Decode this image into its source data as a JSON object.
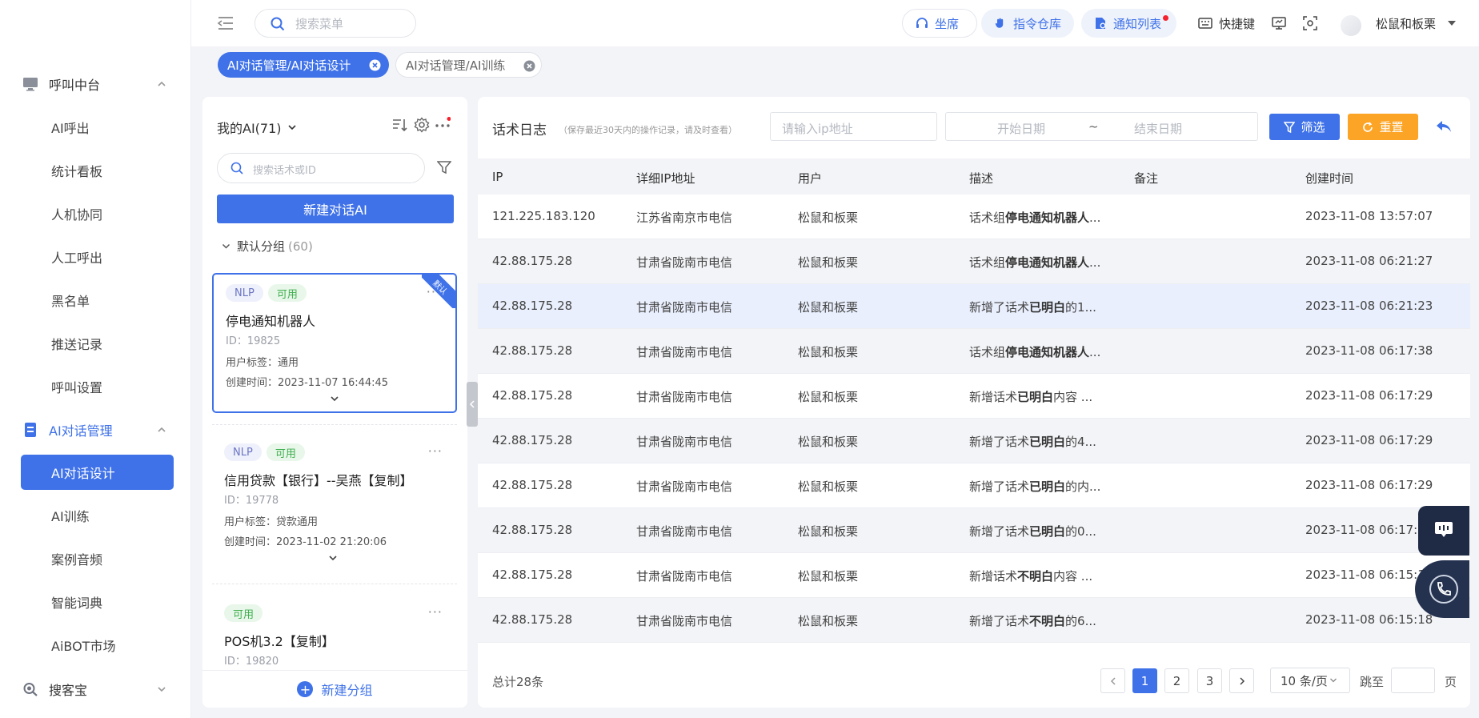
{
  "sidebar": {
    "groups": [
      {
        "label": "呼叫中台",
        "icon": "monitor-icon",
        "expanded": true
      },
      {
        "label": "AI对话管理",
        "icon": "document-icon",
        "expanded": true
      },
      {
        "label": "搜客宝",
        "icon": "magnifier-icon",
        "expanded": false
      }
    ],
    "call_items": [
      "AI呼出",
      "统计看板",
      "人机协同",
      "人工呼出",
      "黑名单",
      "推送记录",
      "呼叫设置"
    ],
    "ai_items": [
      "AI对话设计",
      "AI训练",
      "案例音频",
      "智能词典",
      "AiBOT市场"
    ],
    "active_item": "AI对话设计"
  },
  "header": {
    "search_placeholder": "搜索菜单",
    "buttons": [
      {
        "label": "坐席",
        "icon": "headset-icon"
      },
      {
        "label": "指令仓库",
        "icon": "hand-icon"
      },
      {
        "label": "通知列表",
        "icon": "bell-doc-icon",
        "has_dot": true
      }
    ],
    "shortcut_label": "快捷键",
    "username": "松鼠和板栗"
  },
  "tabs": [
    {
      "label": "AI对话管理/AI对话设计",
      "active": true
    },
    {
      "label": "AI对话管理/AI训练",
      "active": false
    }
  ],
  "ai_panel": {
    "title": "我的AI(71)",
    "search_placeholder": "搜索话术或ID",
    "new_button": "新建对话AI",
    "group_label": "默认分组",
    "group_count": "(60)",
    "cards": [
      {
        "badges": [
          "NLP",
          "可用"
        ],
        "name": "停电通知机器人",
        "id": "ID：19825",
        "tag": "用户标签：通用",
        "time": "创建时间：2023-11-07 16:44:45",
        "ribbon": "默认",
        "selected": true
      },
      {
        "badges": [
          "NLP",
          "可用"
        ],
        "name": "信用贷款【银行】--吴燕【复制】",
        "id": "ID：19778",
        "tag": "用户标签：贷款通用",
        "time": "创建时间：2023-11-02 21:20:06",
        "selected": false
      },
      {
        "badges": [
          "可用"
        ],
        "name": "POS机3.2【复制】",
        "id": "ID：19820",
        "selected": false
      }
    ],
    "new_group": "新建分组"
  },
  "log_panel": {
    "title": "话术日志",
    "subtitle": "（保存最近30天内的操作记录，请及时查看）",
    "ip_placeholder": "请输入ip地址",
    "date_start": "开始日期",
    "date_sep": "~",
    "date_end": "结束日期",
    "filter_label": "筛选",
    "reset_label": "重置",
    "columns": [
      "IP",
      "详细IP地址",
      "用户",
      "描述",
      "备注",
      "创建时间"
    ],
    "rows": [
      {
        "ip": "121.225.183.120",
        "addr": "江苏省南京市电信",
        "user": "松鼠和板栗",
        "desc_pre": "话术组",
        "desc_bold": "停电通知机器人",
        "desc_post": "...",
        "note": "",
        "time": "2023-11-08 13:57:07"
      },
      {
        "ip": "42.88.175.28",
        "addr": "甘肃省陇南市电信",
        "user": "松鼠和板栗",
        "desc_pre": "话术组",
        "desc_bold": "停电通知机器人",
        "desc_post": "...",
        "note": "",
        "time": "2023-11-08 06:21:27"
      },
      {
        "ip": "42.88.175.28",
        "addr": "甘肃省陇南市电信",
        "user": "松鼠和板栗",
        "desc_pre": "新增了话术",
        "desc_bold": "已明白",
        "desc_post": "的1...",
        "note": "",
        "time": "2023-11-08 06:21:23"
      },
      {
        "ip": "42.88.175.28",
        "addr": "甘肃省陇南市电信",
        "user": "松鼠和板栗",
        "desc_pre": "话术组",
        "desc_bold": "停电通知机器人",
        "desc_post": "...",
        "note": "",
        "time": "2023-11-08 06:17:38"
      },
      {
        "ip": "42.88.175.28",
        "addr": "甘肃省陇南市电信",
        "user": "松鼠和板栗",
        "desc_pre": "新增话术",
        "desc_bold": "已明白",
        "desc_post": "内容 ...",
        "note": "",
        "time": "2023-11-08 06:17:29"
      },
      {
        "ip": "42.88.175.28",
        "addr": "甘肃省陇南市电信",
        "user": "松鼠和板栗",
        "desc_pre": "新增了话术",
        "desc_bold": "已明白",
        "desc_post": "的4...",
        "note": "",
        "time": "2023-11-08 06:17:29"
      },
      {
        "ip": "42.88.175.28",
        "addr": "甘肃省陇南市电信",
        "user": "松鼠和板栗",
        "desc_pre": "新增了话术",
        "desc_bold": "已明白",
        "desc_post": "的内...",
        "note": "",
        "time": "2023-11-08 06:17:29"
      },
      {
        "ip": "42.88.175.28",
        "addr": "甘肃省陇南市电信",
        "user": "松鼠和板栗",
        "desc_pre": "新增了话术",
        "desc_bold": "已明白",
        "desc_post": "的0...",
        "note": "",
        "time": "2023-11-08 06:17:2"
      },
      {
        "ip": "42.88.175.28",
        "addr": "甘肃省陇南市电信",
        "user": "松鼠和板栗",
        "desc_pre": "新增话术",
        "desc_bold": "不明白",
        "desc_post": "内容 ...",
        "note": "",
        "time": "2023-11-08 06:15:1"
      },
      {
        "ip": "42.88.175.28",
        "addr": "甘肃省陇南市电信",
        "user": "松鼠和板栗",
        "desc_pre": "新增了话术",
        "desc_bold": "不明白",
        "desc_post": "的6...",
        "note": "",
        "time": "2023-11-08 06:15:18"
      }
    ],
    "total": "总计28条",
    "pages": [
      "1",
      "2",
      "3"
    ],
    "current_page": "1",
    "page_size": "10 条/页",
    "jump_label": "跳至",
    "jump_suffix": "页"
  },
  "colors": {
    "primary": "#3f72e8",
    "warning": "#fca426",
    "success": "#3fae4d",
    "danger": "#f5222d"
  }
}
